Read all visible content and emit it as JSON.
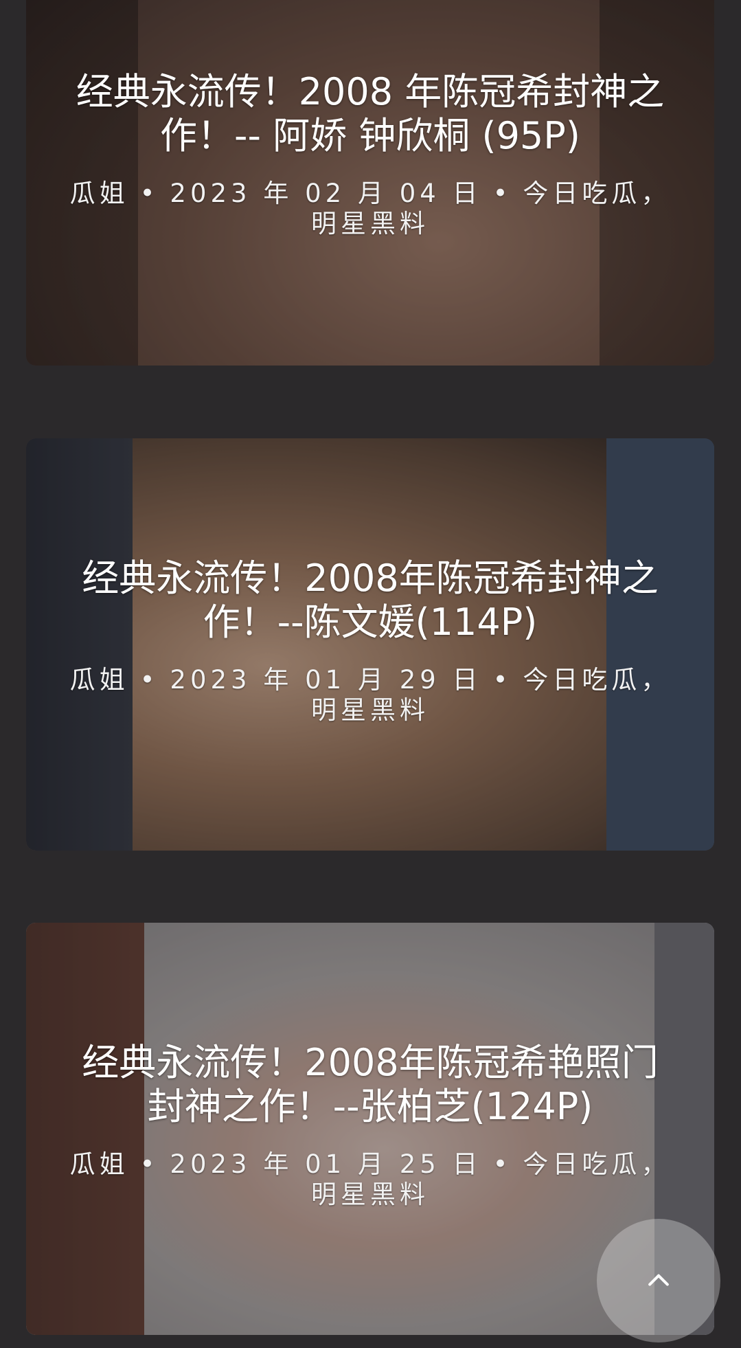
{
  "posts": [
    {
      "title": "经典永流传！2008 年陈冠希封神之作！-- 阿娇 钟欣桐 (95P)",
      "author": "瓜姐",
      "date": "2023 年 02 月 04 日",
      "categories": "今日吃瓜，明星黑料"
    },
    {
      "title": "经典永流传！2008年陈冠希封神之作！--陈文媛(114P)",
      "author": "瓜姐",
      "date": "2023 年 01 月 29 日",
      "categories": "今日吃瓜，明星黑料"
    },
    {
      "title": "经典永流传！2008年陈冠希艳照门封神之作！--张柏芝(124P)",
      "author": "瓜姐",
      "date": "2023 年 01 月 25 日",
      "categories": "今日吃瓜，明星黑料"
    }
  ],
  "meta_separator": "•",
  "back_to_top_icon": "chevron-up-icon"
}
